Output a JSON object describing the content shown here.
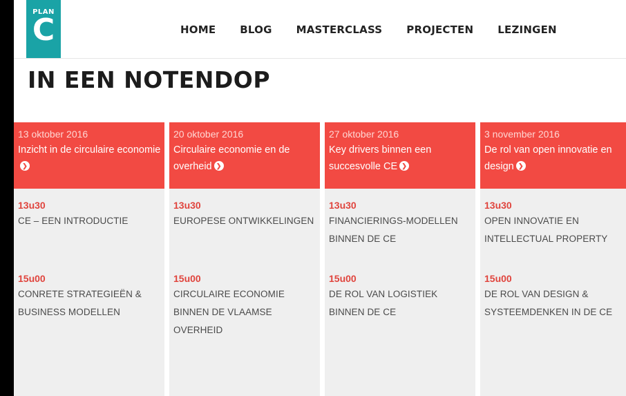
{
  "logo": {
    "small": "PLAN",
    "big": "C"
  },
  "nav": [
    "HOME",
    "BLOG",
    "MASTERCLASS",
    "PROJECTEN",
    "LEZINGEN"
  ],
  "page_title": "IN EEN NOTENDOP",
  "colors": {
    "accent": "#f24a43",
    "logo": "#1aa3a6",
    "card_bg": "#efefef"
  },
  "cards": [
    {
      "date": "13 oktober 2016",
      "title": "Inzicht in de circulaire economie",
      "sessions": [
        {
          "time": "13u30",
          "title": "CE – EEN INTRODUCTIE"
        },
        {
          "time": "15u00",
          "title": "CONRETE STRATEGIEËN & BUSINESS MODELLEN"
        }
      ]
    },
    {
      "date": "20 oktober 2016",
      "title": "Circulaire economie en de overheid",
      "sessions": [
        {
          "time": "13u30",
          "title": "EUROPESE ONTWIKKELINGEN"
        },
        {
          "time": "15u00",
          "title": "CIRCULAIRE ECONOMIE BINNEN DE VLAAMSE OVERHEID"
        }
      ]
    },
    {
      "date": "27 oktober 2016",
      "title": "Key drivers binnen een succesvolle CE",
      "sessions": [
        {
          "time": "13u30",
          "title": "FINANCIERINGS-MODELLEN BINNEN DE CE"
        },
        {
          "time": "15u00",
          "title": "DE ROL VAN LOGISTIEK BINNEN DE CE"
        }
      ]
    },
    {
      "date": "3 november 2016",
      "title": "De rol van open innovatie en design",
      "sessions": [
        {
          "time": "13u30",
          "title": "OPEN INNOVATIE EN INTELLECTUAL PROPERTY"
        },
        {
          "time": "15u00",
          "title": "DE ROL VAN DESIGN & SYSTEEMDENKEN IN DE CE"
        }
      ]
    }
  ]
}
